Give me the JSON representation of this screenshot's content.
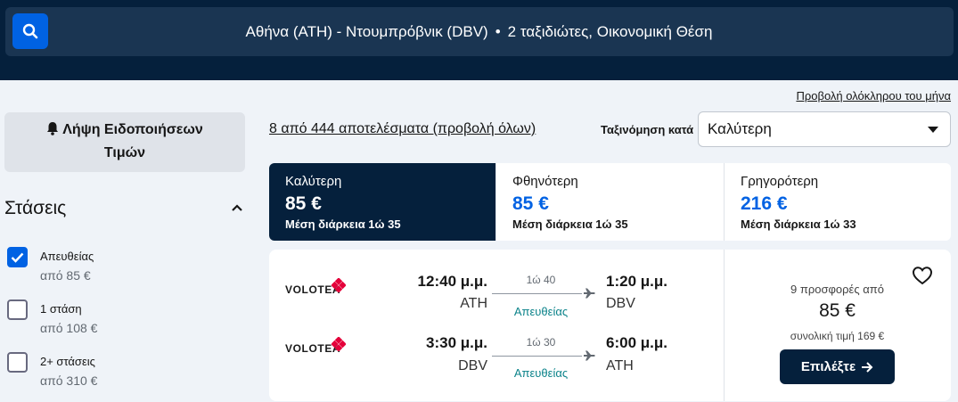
{
  "search": {
    "route": "Αθήνα (ATH) - Ντουμπρόβνικ (DBV)",
    "separator": "•",
    "travellers": "2 ταξιδιώτες, Οικονομική Θέση",
    "icon": "search-icon"
  },
  "month_link": "Προβολή ολόκληρου του μήνα",
  "price_alert": {
    "line1": "Λήψη Ειδοποιήσεων",
    "line2": "Τιμών",
    "icon": "bell-icon"
  },
  "stops": {
    "title": "Στάσεις",
    "options": [
      {
        "label": "Απευθείας",
        "price": "από 85 €",
        "checked": true
      },
      {
        "label": "1 στάση",
        "price": "από 108 €",
        "checked": false
      },
      {
        "label": "2+ στάσεις",
        "price": "από 310 €",
        "checked": false
      }
    ]
  },
  "results": {
    "count_text": "8 από 444 αποτελέσματα (προβολή όλων)",
    "sort_label": "Ταξινόμηση κατά",
    "sort_value": "Καλύτερη"
  },
  "sort_tabs": [
    {
      "name": "Καλύτερη",
      "price": "85 €",
      "duration": "Μέση διάρκεια 1ώ 35",
      "active": true
    },
    {
      "name": "Φθηνότερη",
      "price": "85 €",
      "duration": "Μέση διάρκεια 1ώ 35",
      "active": false
    },
    {
      "name": "Γρηγορότερη",
      "price": "216 €",
      "duration": "Μέση διάρκεια 1ώ 33",
      "active": false
    }
  ],
  "itinerary": {
    "legs": [
      {
        "airline": "VOLOTEA",
        "dep_time": "12:40 μ.μ.",
        "dep_code": "ATH",
        "duration": "1ώ 40",
        "stops": "Απευθείας",
        "arr_time": "1:20 μ.μ.",
        "arr_code": "DBV"
      },
      {
        "airline": "VOLOTEA",
        "dep_time": "3:30 μ.μ.",
        "dep_code": "DBV",
        "duration": "1ώ 30",
        "stops": "Απευθείας",
        "arr_time": "6:00 μ.μ.",
        "arr_code": "ATH"
      }
    ],
    "deals": "9 προσφορές από",
    "price": "85 €",
    "total": "συνολική τιμή 169 €",
    "select_label": "Επιλέξτε"
  },
  "colors": {
    "navy": "#05203c",
    "blue": "#0062e3",
    "teal": "#0c838a",
    "volotea_red": "#e4003a"
  }
}
